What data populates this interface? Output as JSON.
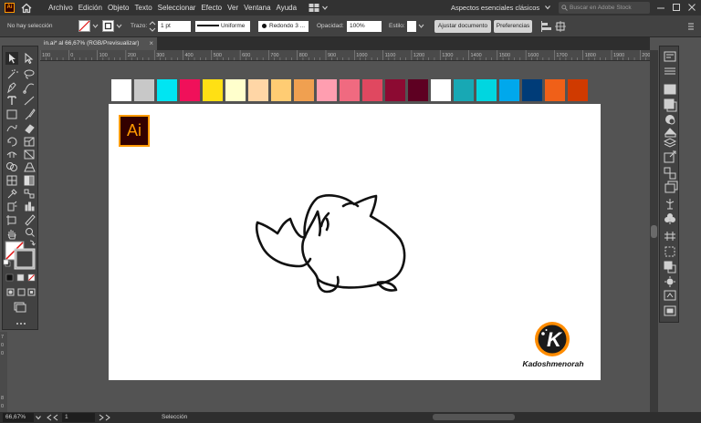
{
  "menubar": {
    "app_icon_text": "Ai",
    "items": [
      "Archivo",
      "Edición",
      "Objeto",
      "Texto",
      "Seleccionar",
      "Efecto",
      "Ver",
      "Ventana",
      "Ayuda"
    ],
    "workspace": "Aspectos esenciales clásicos",
    "stock_search_placeholder": "Buscar en Adobe Stock",
    "icons": [
      "home-icon",
      "workspace-switcher-icon",
      "arrange-documents-icon",
      "search-icon",
      "minimize-icon",
      "maximize-icon",
      "close-icon"
    ]
  },
  "controlbar": {
    "selection_status": "No hay selección",
    "stroke_label": "Trazo:",
    "stroke_weight": "1 pt",
    "stroke_profile": "Uniforme",
    "brush": "Redondo 3 ...",
    "opacity_label": "Opacidad:",
    "opacity_value": "100%",
    "style_label": "Estilo:",
    "adjust_document": "Ajustar documento",
    "preferences": "Preferencias"
  },
  "document": {
    "tab_title": "in.ai* al 66,67% (RGB/Previsualizar)",
    "tab_close": "×"
  },
  "ruler": {
    "h_labels": [
      "100",
      "0",
      "100",
      "200",
      "300",
      "400",
      "500",
      "600",
      "700",
      "800",
      "900",
      "1000",
      "1100",
      "1200",
      "1300",
      "1400",
      "1500",
      "1600",
      "1700",
      "1800",
      "1900",
      "2000"
    ],
    "v_labels": [
      "7",
      "0",
      "0",
      "8",
      "0",
      "0"
    ]
  },
  "artboard": {
    "ai_badge": "Ai",
    "brand_letter": "K",
    "brand_name": "Kadoshmenorah",
    "swatches": [
      "#ffffff",
      "#c8c8c8",
      "#00e5f2",
      "#f0105a",
      "#ffe014",
      "#ffffcc",
      "#ffd6a6",
      "#ffcc73",
      "#f0a050",
      "#ff9eb0",
      "#f06a80",
      "#e04860",
      "#8c0a32",
      "#5e0022",
      "#ffffff",
      "#18a8b4",
      "#00d6e0",
      "#00a8ec",
      "#003c78",
      "#f06018",
      "#d03a00"
    ]
  },
  "statusbar": {
    "zoom": "66,67%",
    "artboard_number": "1",
    "mode": "Selección"
  },
  "colors": {
    "ui_dark": "#323232",
    "ui_panel": "#424242",
    "canvas_bg": "#535353",
    "accent_ai": "#ff9a00"
  }
}
